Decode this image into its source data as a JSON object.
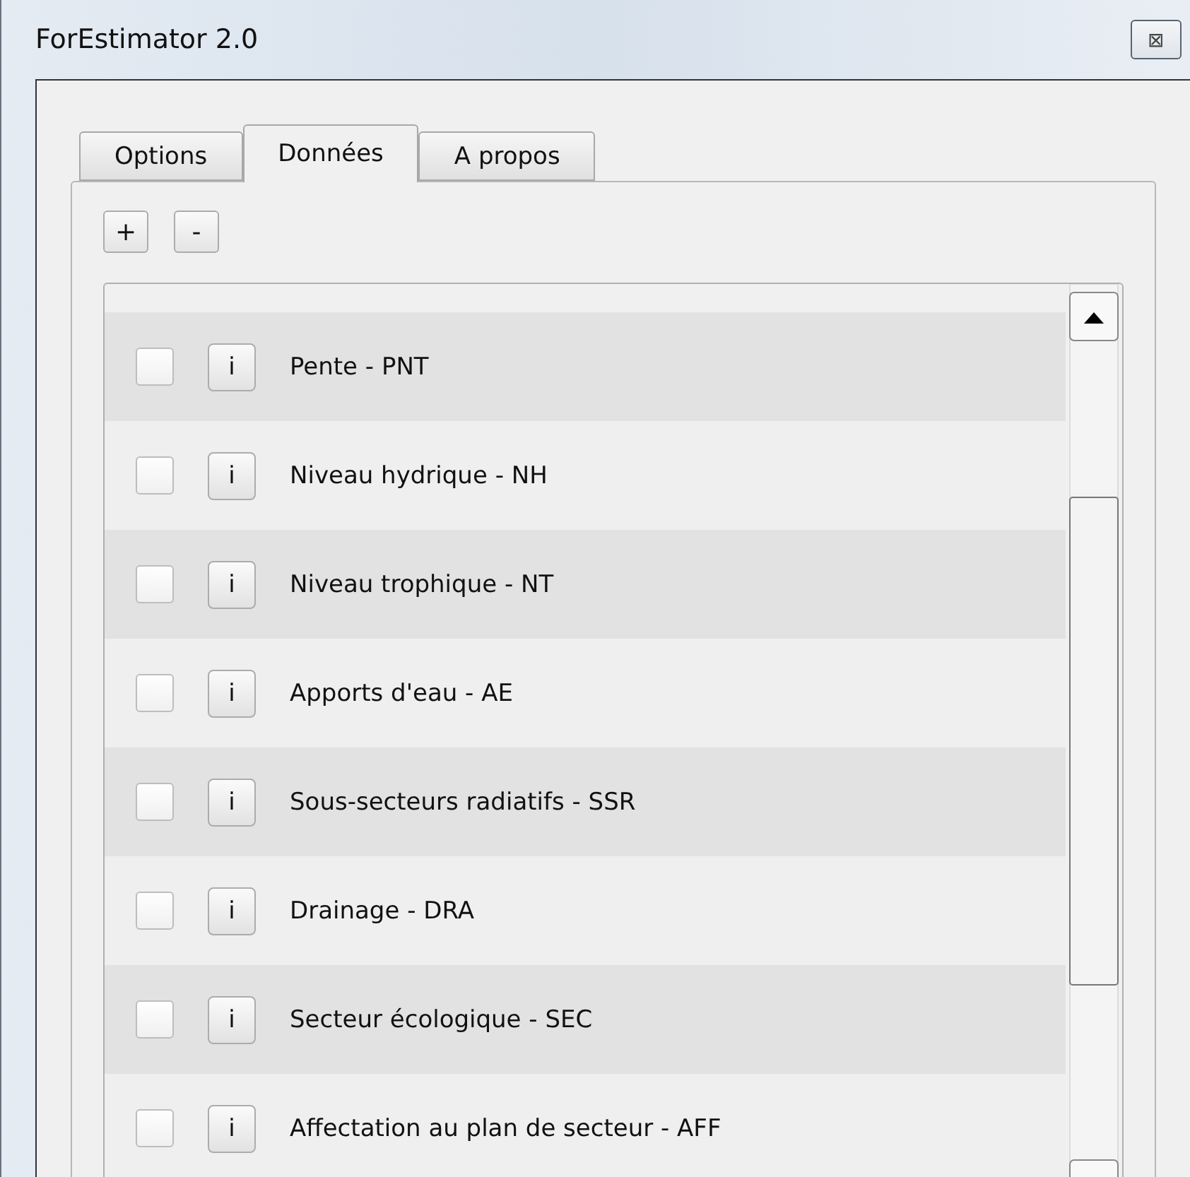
{
  "window": {
    "title": "ForEstimator 2.0",
    "close": "⊠"
  },
  "tabs": [
    {
      "label": "Options",
      "selected": false
    },
    {
      "label": "Données",
      "selected": true
    },
    {
      "label": "A propos",
      "selected": false
    }
  ],
  "toolbar": [
    "+",
    "-"
  ],
  "items": [
    {
      "label": "Pente - PNT",
      "checked": false,
      "info": "i"
    },
    {
      "label": "Niveau hydrique - NH",
      "checked": false,
      "info": "i"
    },
    {
      "label": "Niveau trophique - NT",
      "checked": false,
      "info": "i"
    },
    {
      "label": "Apports d'eau - AE",
      "checked": false,
      "info": "i"
    },
    {
      "label": "Sous-secteurs radiatifs - SSR",
      "checked": false,
      "info": "i"
    },
    {
      "label": "Drainage - DRA",
      "checked": false,
      "info": "i"
    },
    {
      "label": "Secteur écologique - SEC",
      "checked": false,
      "info": "i"
    },
    {
      "label": "Affectation au plan de secteur - AFF",
      "checked": false,
      "info": "i"
    }
  ]
}
